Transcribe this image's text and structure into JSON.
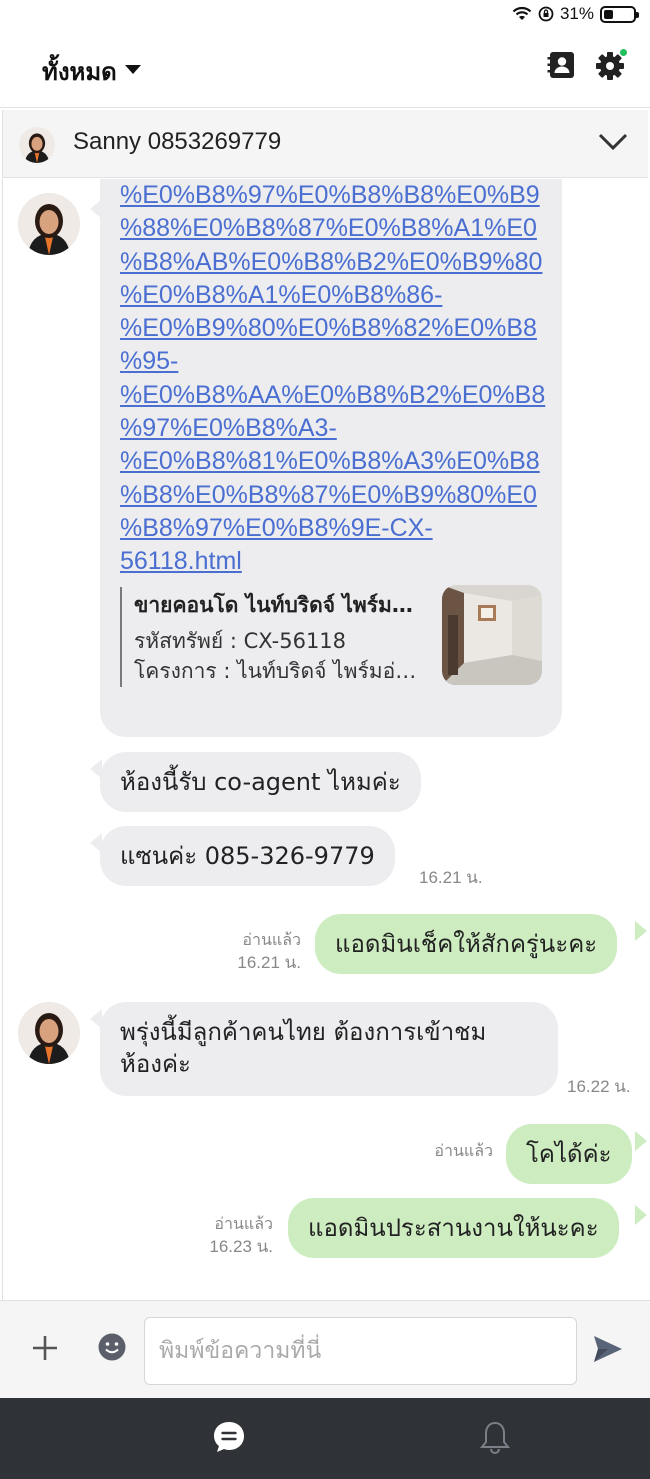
{
  "status_bar": {
    "battery_text": "31%",
    "battery_level": 0.31
  },
  "header": {
    "filter_label": "ทั้งหมด"
  },
  "chat": {
    "contact_name": "Sanny 0853269779",
    "url_lines": [
      "%E0%B8%97%E0%B8%B8%E0%B9",
      "%88%E0%B8%87%E0%B8%A1%E0",
      "%B8%AB%E0%B8%B2%E0%B9%80",
      "%E0%B8%A1%E0%B8%86-",
      "%E0%B9%80%E0%B8%82%E0%B8",
      "%95-",
      "%E0%B8%AA%E0%B8%B2%E0%B8",
      "%97%E0%B8%A3-",
      "%E0%B8%81%E0%B8%A3%E0%B8",
      "%B8%E0%B8%87%E0%B9%80%E0",
      "%B8%97%E0%B8%9E-CX-",
      "56118.html"
    ],
    "preview": {
      "title": "ขายคอนโด ไนท์บริดจ์ ไพร์มอ่อนนุช",
      "line1": "รหัสทรัพย์ : CX-56118",
      "line2": "โครงการ : ไนท์บริดจ์ ไพร์มอ่อนนุช"
    },
    "messages": {
      "in_1": "ห้องนี้รับ co-agent ไหมค่ะ",
      "in_2": "แซนค่ะ  085-326-9779",
      "in_2_time": "16.21 น.",
      "out_1": "แอดมินเช็คให้สักครู่นะคะ",
      "out_1_read": "อ่านแล้ว",
      "out_1_time": "16.21 น.",
      "in_3_line1": "พรุ่งนี้มีลูกค้าคนไทย ต้องการเข้าชม",
      "in_3_line2": "ห้องค่ะ",
      "in_3_time": "16.22 น.",
      "out_2": "โคได้ค่ะ",
      "out_2_read": "อ่านแล้ว",
      "out_3": "แอดมินประสานงานให้นะคะ",
      "out_3_read": "อ่านแล้ว",
      "out_3_time": "16.23 น."
    }
  },
  "composer": {
    "placeholder": "พิมพ์ข้อความที่นี่"
  },
  "colors": {
    "incoming_bubble": "#ededf0",
    "outgoing_bubble": "#cdecc0",
    "link": "#4a6fd1",
    "bottom_nav": "#2f3236",
    "online_dot": "#20c05a"
  },
  "icons": [
    "wifi-icon",
    "orientation-lock-icon",
    "battery-icon",
    "contact-card-icon",
    "gear-icon",
    "chevron-down-icon",
    "plus-icon",
    "emoji-icon",
    "send-icon",
    "chat-bubble-icon",
    "bell-icon"
  ]
}
